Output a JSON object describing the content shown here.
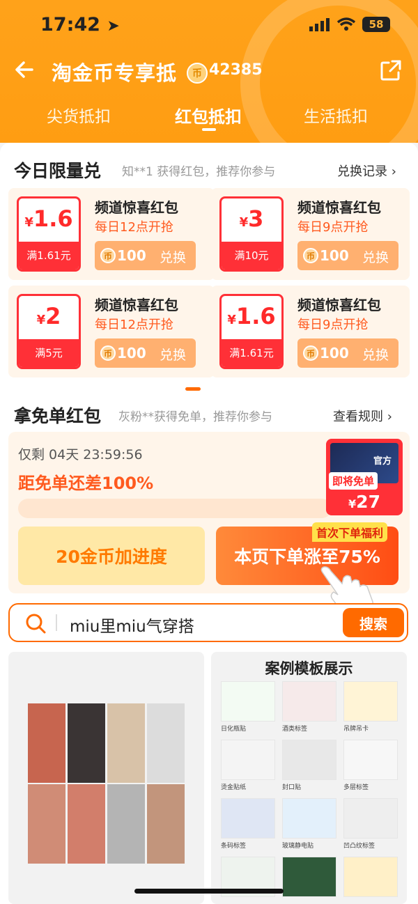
{
  "status_bar": {
    "time": "17:42",
    "battery": "58"
  },
  "header": {
    "title": "淘金币专享抵",
    "coin_count": "42385",
    "coin_symbol": "币",
    "tabs": [
      {
        "label": "尖货抵扣",
        "active": false
      },
      {
        "label": "红包抵扣",
        "active": true
      },
      {
        "label": "生活抵扣",
        "active": false
      }
    ]
  },
  "limited": {
    "title": "今日限量兑",
    "subtitle": "知**1 获得红包，推荐你参与",
    "link": "兑换记录",
    "cards": [
      {
        "amount": "1.6",
        "threshold": "满1.61元",
        "name": "频道惊喜红包",
        "time": "每日12点开抢",
        "coins": "100",
        "action": "兑换"
      },
      {
        "amount": "3",
        "threshold": "满10元",
        "name": "频道惊喜红包",
        "time": "每日9点开抢",
        "coins": "100",
        "action": "兑换"
      },
      {
        "amount": "2",
        "threshold": "满5元",
        "name": "频道惊喜红包",
        "time": "每日12点开抢",
        "coins": "100",
        "action": "兑换"
      },
      {
        "amount": "1.6",
        "threshold": "满1.61元",
        "name": "频道惊喜红包",
        "time": "每日9点开抢",
        "coins": "100",
        "action": "兑换"
      }
    ]
  },
  "free_order": {
    "title": "拿免单红包",
    "subtitle": "灰粉**获得免单，推荐你参与",
    "link": "查看规则",
    "countdown": "仅剩 04天 23:59:56",
    "progress_text": "距免单还差100%",
    "progress_percent": 0,
    "btn_coins": "20金币加进度",
    "btn_order": "本页下单涨至75%",
    "first_order_tag": "首次下单福利",
    "product": {
      "img_text": "官方",
      "free_tag": "即将免单",
      "currency": "¥",
      "price": "27"
    }
  },
  "search": {
    "query": "miu里miu气穿搭",
    "button": "搜索"
  },
  "feed": {
    "right_title": "案例模板展示",
    "templates": [
      "日化瓶贴",
      "酒类标签",
      "吊牌吊卡",
      "烫金贴纸",
      "封口贴",
      "多层标签",
      "条码标签",
      "玻璃静电贴",
      "凹凸纹标签"
    ]
  },
  "colors": {
    "brand_orange": "#ff9d12",
    "accent_red": "#ff3037",
    "accent_orange": "#ff6a00"
  }
}
